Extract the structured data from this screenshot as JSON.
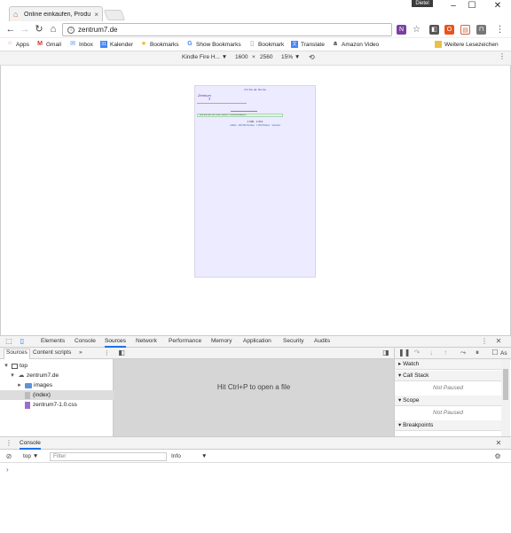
{
  "browser": {
    "tab_title": "Online einkaufen, Produ",
    "profile": "Dietel",
    "url": "zentrum7.de"
  },
  "bookmarks": [
    {
      "label": "Apps",
      "icon": "apps-grid-icon",
      "color": "#d04a2a"
    },
    {
      "label": "Gmail",
      "icon": "gmail-icon",
      "color": "#d93025"
    },
    {
      "label": "Inbox",
      "icon": "inbox-icon",
      "color": "#4285f4"
    },
    {
      "label": "Kalender",
      "icon": "calendar-icon",
      "color": "#4285f4"
    },
    {
      "label": "Bookmarks",
      "icon": "star-icon",
      "color": "#e6b800"
    },
    {
      "label": "Show Bookmarks",
      "icon": "google-icon",
      "color": "#4285f4"
    },
    {
      "label": "Bookmark",
      "icon": "page-icon",
      "color": "#888888"
    },
    {
      "label": "Translate",
      "icon": "translate-icon",
      "color": "#4285f4"
    },
    {
      "label": "Amazon Video",
      "icon": "amazon-icon",
      "color": "#222222"
    },
    {
      "label": "Weitere Lesezeichen",
      "icon": "folder-icon",
      "color": "#e8c04a"
    }
  ],
  "device_toolbar": {
    "device": "Kindle Fire H...",
    "width": "1600",
    "times": "×",
    "height": "2560",
    "zoom": "15%"
  },
  "preview": {
    "header": "Für Sie da: Mo-Sa",
    "logo_line1": "Zentrum",
    "logo_line2": "7",
    "box_text": "Wie können wir Ihnen helfen? Online einkaufen",
    "counter": "1 000 · 1 014",
    "counter_sub": "Artikel · 100 000 Kunden · 1 000 Partner · Versand"
  },
  "devtools": {
    "tabs": [
      "Elements",
      "Console",
      "Sources",
      "Network",
      "Performance",
      "Memory",
      "Application",
      "Security",
      "Audits"
    ],
    "active_tab": "Sources",
    "navigator_tabs": [
      "Sources",
      "Content scripts",
      "»"
    ],
    "tree": {
      "top": "top",
      "domain": "zentrum7.de",
      "folder": "images",
      "index": "(index)",
      "css": "zentrum7-1.0.css"
    },
    "editor_hint": "Hit Ctrl+P to open a file",
    "debugger": {
      "watch": "Watch",
      "call_stack": "Call Stack",
      "not_paused_1": "Not Paused",
      "scope": "Scope",
      "not_paused_2": "Not Paused",
      "breakpoints": "Breakpoints",
      "async": "As"
    },
    "console": {
      "tab": "Console",
      "context": "top",
      "filter_placeholder": "Filter",
      "level": "Info",
      "prompt": "›"
    }
  }
}
